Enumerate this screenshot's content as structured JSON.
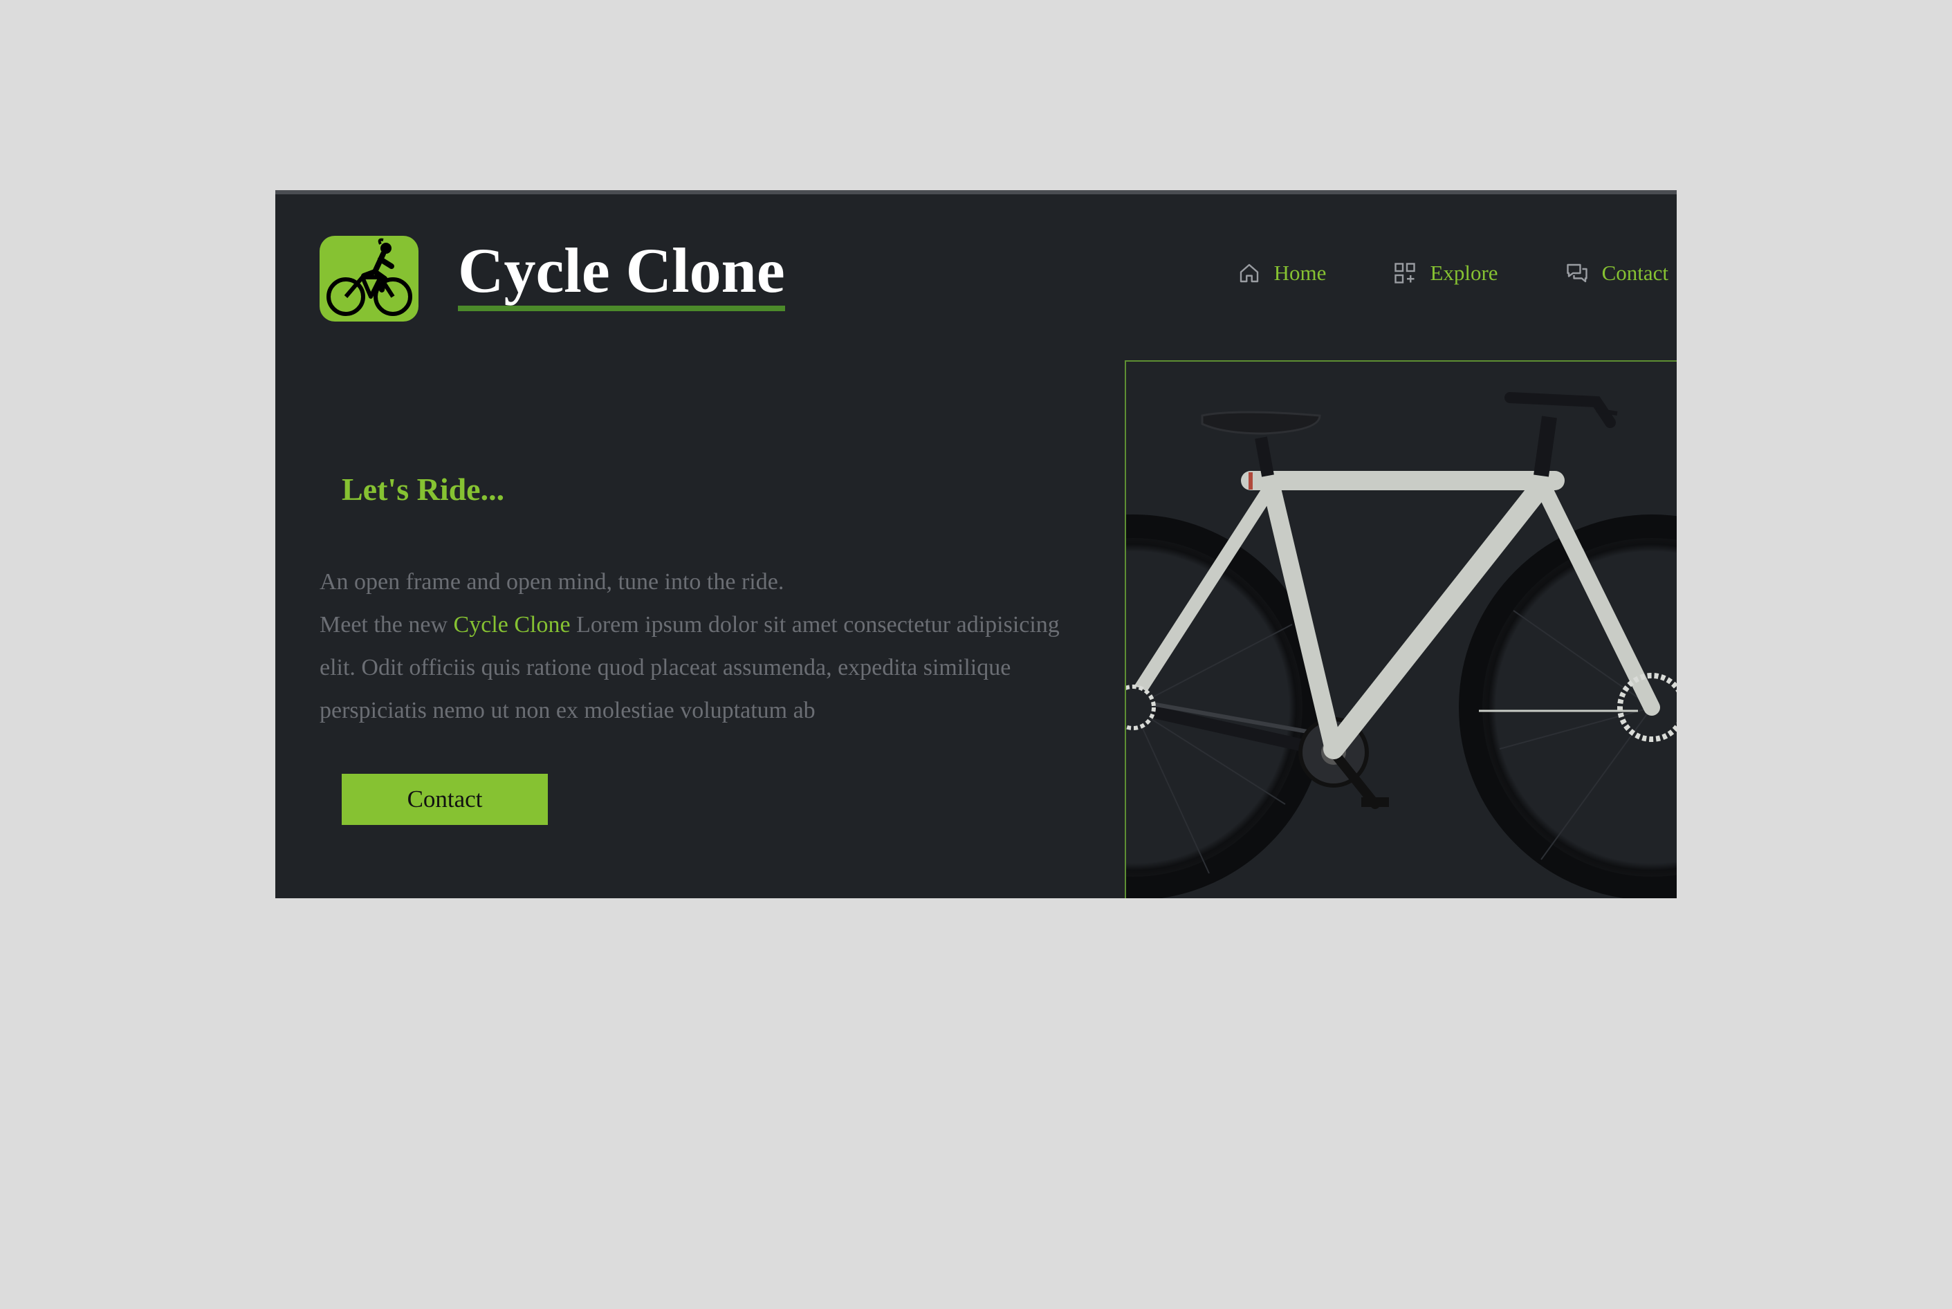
{
  "brand": {
    "title": "Cycle Clone",
    "logo_icon": "cyclist-icon",
    "accent_color": "#86c232",
    "background_color": "#202327"
  },
  "nav": {
    "items": [
      {
        "label": "Home",
        "icon": "home-icon"
      },
      {
        "label": "Explore",
        "icon": "grid-icon"
      },
      {
        "label": "Contact",
        "icon": "chat-icon"
      }
    ]
  },
  "hero": {
    "tagline": "Let's Ride...",
    "line1": "An open frame and open mind, tune into the ride.",
    "line2_prefix": "Meet the new ",
    "line2_highlight": "Cycle Clone",
    "line2_suffix": " Lorem ipsum dolor sit amet consectetur adipisicing elit. Odit officiis quis ratione quod placeat assumenda, expedita similique perspiciatis nemo ut non ex molestiae voluptatum ab",
    "cta_label": "Contact",
    "image": "bicycle-photo"
  }
}
